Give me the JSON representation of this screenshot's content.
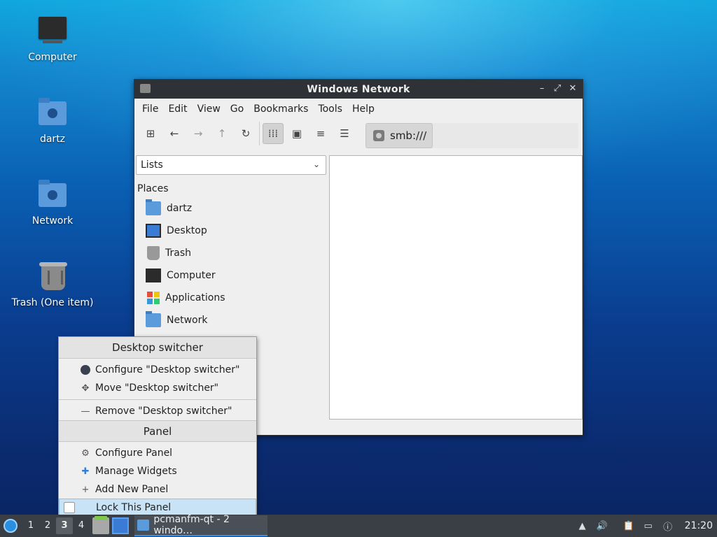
{
  "desktop": {
    "icons": [
      {
        "label": "Computer"
      },
      {
        "label": "dartz"
      },
      {
        "label": "Network"
      },
      {
        "label": "Trash (One item)"
      }
    ]
  },
  "window": {
    "title": "Windows Network",
    "controls": {
      "minimize": "–",
      "maximize": "⤢",
      "close": "✕"
    },
    "menu": [
      "File",
      "Edit",
      "View",
      "Go",
      "Bookmarks",
      "Tools",
      "Help"
    ],
    "toolbar_icons": [
      "new-tab-icon",
      "back-icon",
      "forward-icon",
      "up-icon",
      "reload-icon",
      "icon-view-icon",
      "thumbnail-view-icon",
      "compact-view-icon",
      "detailed-list-icon"
    ],
    "address": "smb:///",
    "side_select": "Lists",
    "places_heading": "Places",
    "places": [
      {
        "label": "dartz"
      },
      {
        "label": "Desktop"
      },
      {
        "label": "Trash"
      },
      {
        "label": "Computer"
      },
      {
        "label": "Applications"
      },
      {
        "label": "Network"
      }
    ]
  },
  "context_menu": {
    "section1": "Desktop switcher",
    "configure_applet": "Configure \"Desktop switcher\"",
    "move_applet": "Move \"Desktop switcher\"",
    "remove_applet": "Remove \"Desktop switcher\"",
    "section2": "Panel",
    "configure_panel": "Configure Panel",
    "manage_widgets": "Manage Widgets",
    "add_panel": "Add New Panel",
    "lock_panel": "Lock This Panel"
  },
  "taskbar": {
    "desktops": [
      "1",
      "2",
      "3",
      "4"
    ],
    "active_desktop": "3",
    "task_label": "pcmanfm-qt - 2 windo…",
    "clock": "21:20"
  },
  "colors": {
    "accent": "#3b8fe5",
    "panel": "#3a3f45",
    "titlebar": "#2e3136",
    "menu_highlight": "#c9e3f6"
  }
}
